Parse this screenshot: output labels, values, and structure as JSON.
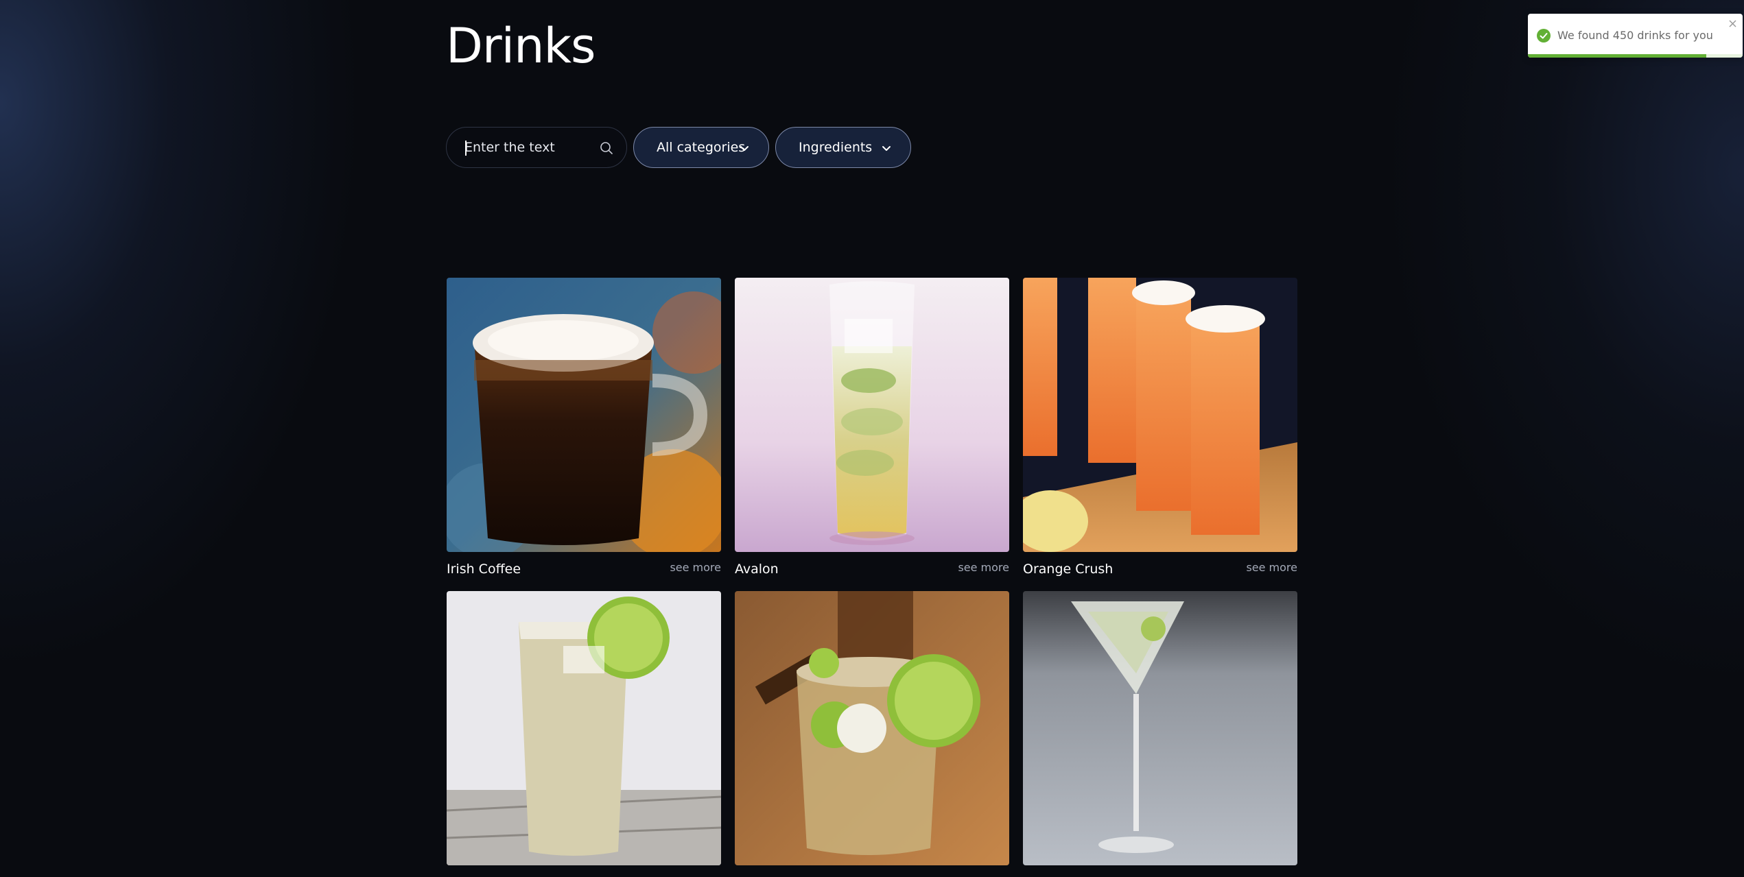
{
  "page": {
    "title": "Drinks"
  },
  "filters": {
    "search_placeholder": "Enter the text",
    "search_value": "",
    "category_selected": "All categories",
    "ingredients_selected": "Ingredients"
  },
  "drinks": [
    {
      "name": "Irish Coffee",
      "see_more": "see more",
      "image": "irish-coffee-photo"
    },
    {
      "name": "Avalon",
      "see_more": "see more",
      "image": "avalon-photo"
    },
    {
      "name": "Orange Crush",
      "see_more": "see more",
      "image": "orange-crush-photo"
    },
    {
      "image": "highball-lime-photo"
    },
    {
      "image": "lime-rocks-glass-photo"
    },
    {
      "image": "martini-glass-photo"
    }
  ],
  "toast": {
    "message": "We found 450 drinks for you",
    "status": "success",
    "progress": 0.83
  },
  "colors": {
    "background": "#090b10",
    "dropdown_fill": "#17223a",
    "toast_success": "#62b035"
  },
  "icons": {
    "search": "search-icon",
    "dropdown": "chevron-down-icon",
    "toast_status": "check-circle-icon",
    "toast_close": "close-icon"
  }
}
